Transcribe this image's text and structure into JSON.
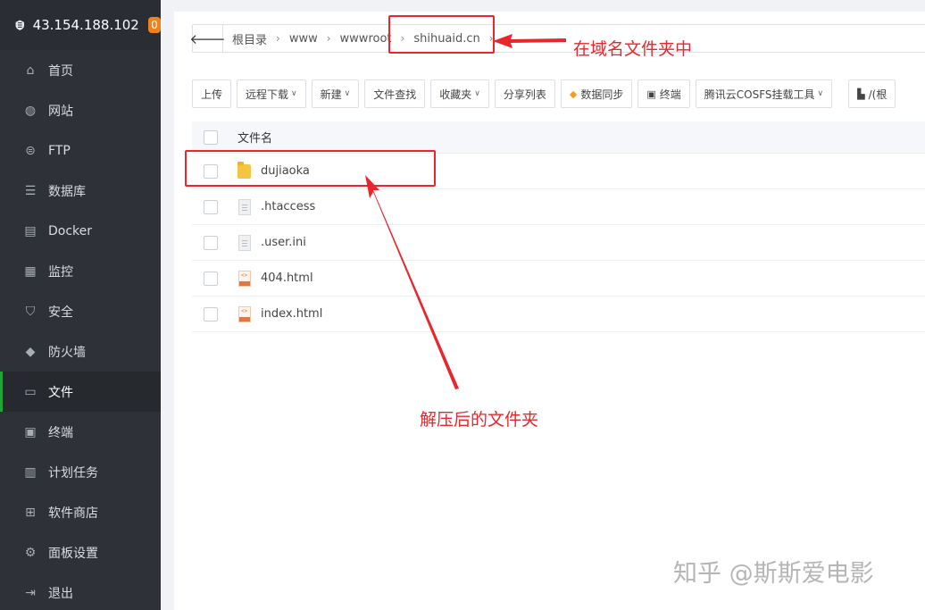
{
  "server": {
    "address": "43.154.188.102",
    "badge": "0"
  },
  "sidebar": {
    "items": [
      {
        "label": "首页",
        "icon": "home-icon"
      },
      {
        "label": "网站",
        "icon": "globe-icon"
      },
      {
        "label": "FTP",
        "icon": "ftp-icon"
      },
      {
        "label": "数据库",
        "icon": "database-icon"
      },
      {
        "label": "Docker",
        "icon": "docker-icon"
      },
      {
        "label": "监控",
        "icon": "monitor-icon"
      },
      {
        "label": "安全",
        "icon": "shield-icon"
      },
      {
        "label": "防火墙",
        "icon": "firewall-icon"
      },
      {
        "label": "文件",
        "icon": "folder-icon",
        "active": true
      },
      {
        "label": "终端",
        "icon": "terminal-icon"
      },
      {
        "label": "计划任务",
        "icon": "calendar-icon"
      },
      {
        "label": "软件商店",
        "icon": "grid-icon"
      },
      {
        "label": "面板设置",
        "icon": "gear-icon"
      },
      {
        "label": "退出",
        "icon": "logout-icon"
      }
    ]
  },
  "breadcrumb": [
    "根目录",
    "www",
    "wwwroot",
    "shihuaid.cn"
  ],
  "toolbar": {
    "upload": "上传",
    "remote_download": "远程下载",
    "new": "新建",
    "file_search": "文件查找",
    "favorites": "收藏夹",
    "share_list": "分享列表",
    "data_sync": "数据同步",
    "terminal": "终端",
    "cosfs": "腾讯云COSFS挂载工具",
    "path_partial": "/(根"
  },
  "table": {
    "header_name": "文件名",
    "rows": [
      {
        "name": "dujiaoka",
        "type": "folder"
      },
      {
        "name": ".htaccess",
        "type": "doc"
      },
      {
        "name": ".user.ini",
        "type": "doc"
      },
      {
        "name": "404.html",
        "type": "html"
      },
      {
        "name": "index.html",
        "type": "html"
      }
    ]
  },
  "annotations": {
    "domain_folder": "在域名文件夹中",
    "extracted_folder": "解压后的文件夹",
    "color": "#e8262c"
  },
  "watermark": "知乎 @斯斯爱电影"
}
